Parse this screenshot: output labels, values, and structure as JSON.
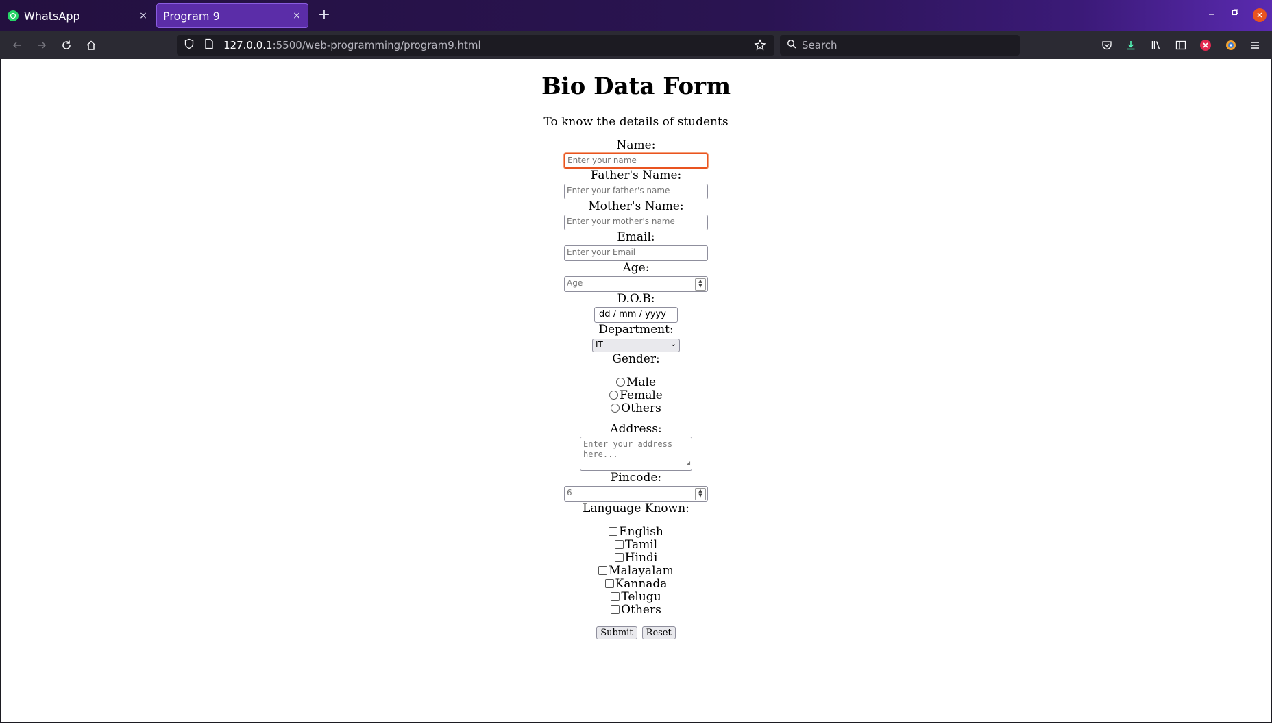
{
  "browser": {
    "tabs": [
      {
        "label": "WhatsApp",
        "close": "×"
      },
      {
        "label": "Program 9",
        "close": "×"
      }
    ],
    "new_tab": "+",
    "url_host": "127.0.0.1",
    "url_rest": ":5500/web-programming/program9.html",
    "search_placeholder": "Search",
    "accent_color": "#5b2da8"
  },
  "page": {
    "title": "Bio Data Form",
    "subtitle": "To know the details of students",
    "fields": {
      "name": {
        "label": "Name:",
        "placeholder": "Enter your name"
      },
      "father": {
        "label": "Father's Name:",
        "placeholder": "Enter your father's name"
      },
      "mother": {
        "label": "Mother's Name:",
        "placeholder": "Enter your mother's name"
      },
      "email": {
        "label": "Email:",
        "placeholder": "Enter your Email"
      },
      "age": {
        "label": "Age:",
        "placeholder": "Age"
      },
      "dob": {
        "label": "D.O.B:",
        "value": "dd / mm / yyyy"
      },
      "department": {
        "label": "Department:",
        "value": "IT"
      },
      "gender": {
        "label": "Gender:",
        "options": [
          "Male",
          "Female",
          "Others"
        ]
      },
      "address": {
        "label": "Address:",
        "placeholder_line1": "Enter your address",
        "placeholder_line2": "here..."
      },
      "pincode": {
        "label": "Pincode:",
        "placeholder": "6-----"
      },
      "languages": {
        "label": "Language Known:",
        "options": [
          "English",
          "Tamil",
          "Hindi",
          "Malayalam",
          "Kannada",
          "Telugu",
          "Others"
        ]
      }
    },
    "buttons": {
      "submit": "Submit",
      "reset": "Reset"
    }
  }
}
